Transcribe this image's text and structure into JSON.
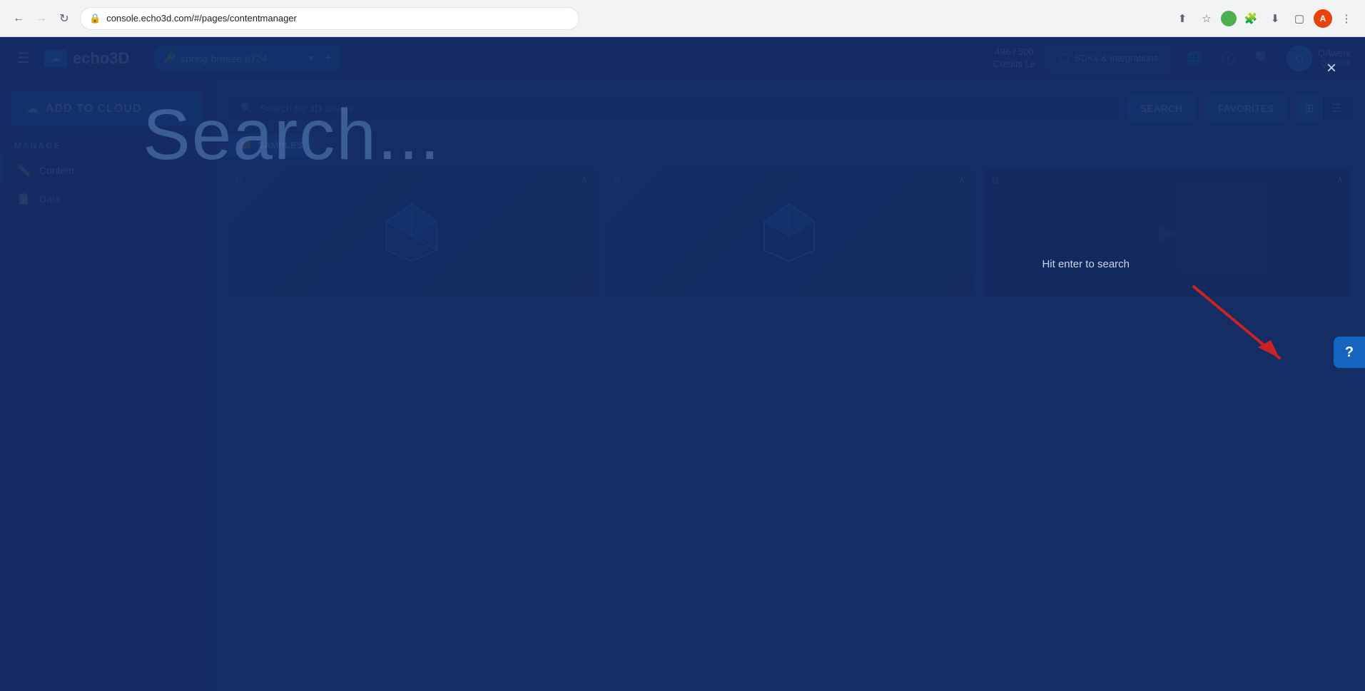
{
  "browser": {
    "url": "console.echo3d.com/#/pages/contentmanager",
    "back_disabled": false,
    "forward_disabled": true
  },
  "overlay": {
    "search_placeholder": "Search...",
    "hit_enter_text": "Hit enter to search",
    "close_label": "×"
  },
  "navbar": {
    "hamburger_label": "☰",
    "logo_text": "echo3D",
    "project": {
      "name": "spring-breeze-6724",
      "add_label": "+"
    },
    "credits": {
      "line1": "496 / 500",
      "line2": "Credits Le"
    },
    "sdk_btn_label": "SDKs & Integrations",
    "user": {
      "name": "QAwerk",
      "role": "QAwerk",
      "initials": "Q"
    }
  },
  "sidebar": {
    "add_to_cloud_label": "ADD TO CLOUD",
    "manage_label": "MANAGE",
    "items": [
      {
        "label": "Content",
        "icon": "✏️"
      },
      {
        "label": "Data",
        "icon": "📋"
      }
    ]
  },
  "content": {
    "search_placeholder": "Search for 3D assets...",
    "search_btn": "SEARCH",
    "favorites_btn": "FAVORITES",
    "samples_label": "SAMPLES",
    "assets": [
      {
        "id": 1,
        "type": "3d",
        "color": "#4fc3f7"
      },
      {
        "id": 2,
        "type": "3d",
        "color": "#4fc3f7"
      },
      {
        "id": 3,
        "type": "video",
        "color": "#1a2d5a"
      }
    ]
  },
  "help": {
    "label": "?"
  }
}
